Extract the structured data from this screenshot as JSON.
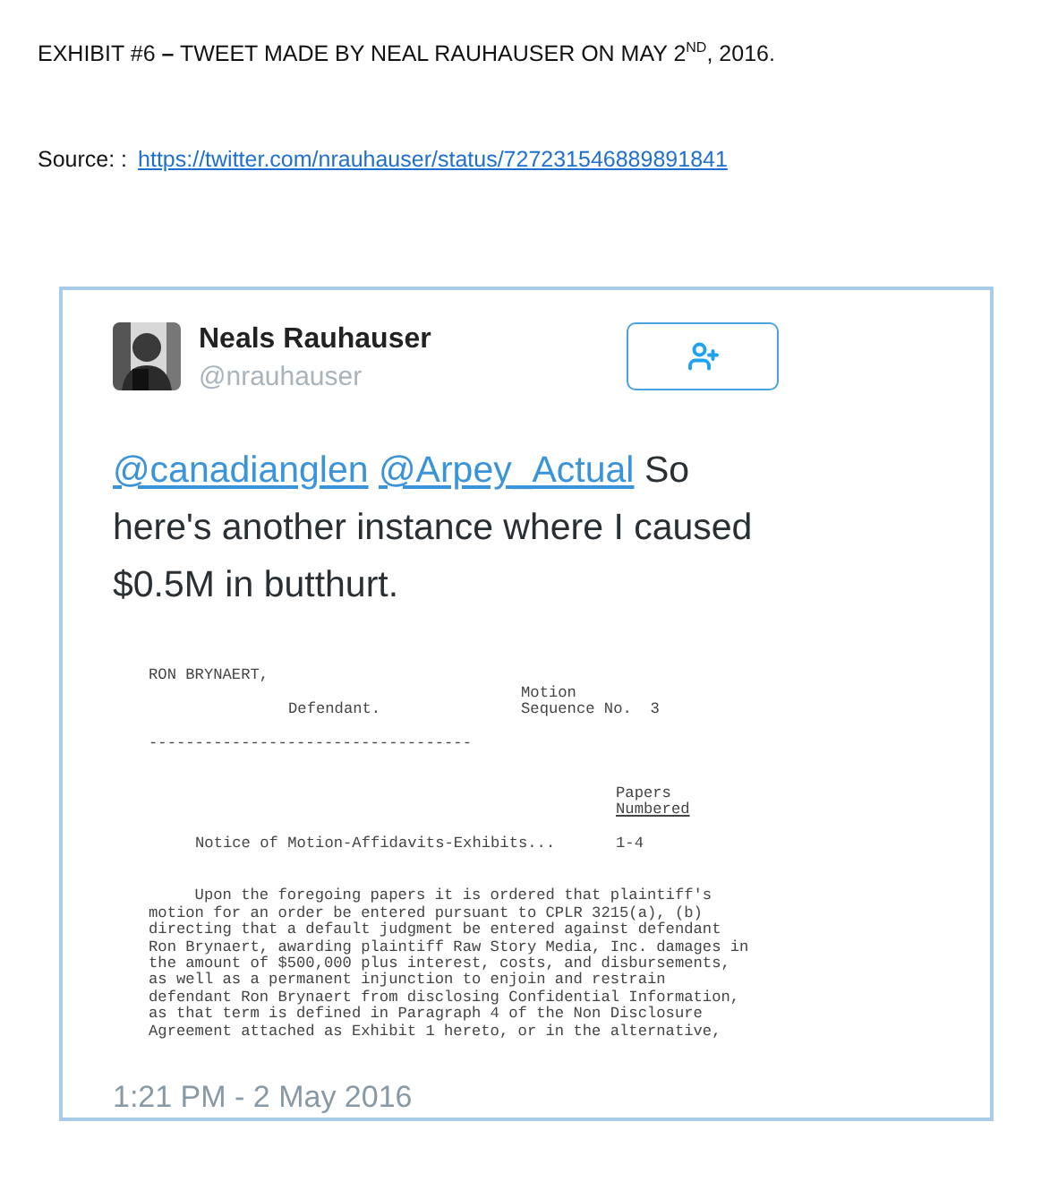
{
  "exhibit": {
    "title": "EXHIBIT #6 **–** TWEET MADE BY NEAL RAUHAUSER ON MAY 2$^{ND}$, 2016.",
    "source_label": "Source: :",
    "source_link": "https://twitter.com/nrauhauser/status/727231546889891841"
  },
  "tweet": {
    "author": "Neals Rauhauser",
    "handle": "@nrauhauser",
    "mentions": [
      "@canadianglen",
      "@Arpey_Actual"
    ],
    "text": "So here's another instance where I caused $0.5M in butthurt.",
    "document": {
      "party": "RON BRYNAERT,",
      "party_role": "Defendant.",
      "motion": "Motion",
      "sequence": "Sequence No.  3",
      "rule": "-----------------------------------",
      "papers_heading": "Papers",
      "papers_subheading": "Numbered",
      "item": "Notice of Motion-Affidavits-Exhibits...",
      "item_pages": "1-4",
      "body": "     Upon the foregoing papers it is ordered that plaintiff's\nmotion for an order be entered pursuant to CPLR 3215(a), (b)\ndirecting that a default judgment be entered against defendant\nRon Brynaert, awarding plaintiff Raw Story Media, Inc. damages in\nthe amount of $500,000 plus interest, costs, and disbursements,\nas well as a permanent injunction to enjoin and restrain\ndefendant Ron Brynaert from disclosing Confidential Information,\nas that term is defined in Paragraph 4 of the Non Disclosure\nAgreement attached as Exhibit 1 hereto, or in the alternative,"
    },
    "timestamp": "1:21 PM - 2 May 2016"
  }
}
